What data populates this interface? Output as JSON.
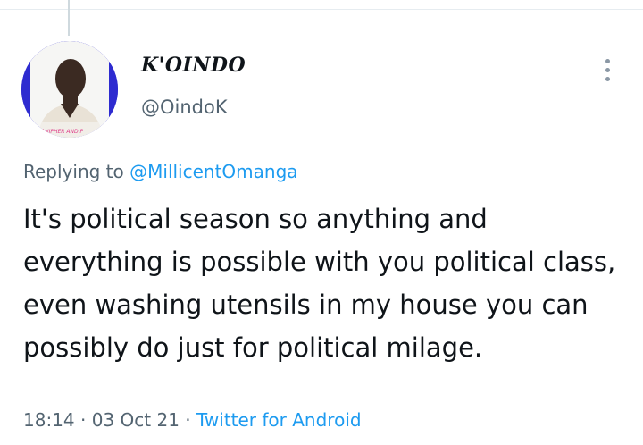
{
  "tweet": {
    "author": {
      "display_name": "K'OINDO",
      "handle": "@OindoK",
      "avatar_caption": "ANIPHER AND P"
    },
    "replying_prefix": "Replying to ",
    "replying_to": "@MillicentOmanga",
    "text": "It's political season so anything and everything is possible with you political class, even washing utensils in my house you can possibly do just for political milage.",
    "time": "18:14",
    "separator": " · ",
    "date": "03 Oct 21",
    "source": "Twitter for Android"
  },
  "icons": {
    "more": "more-vertical-icon"
  },
  "colors": {
    "link": "#1d9bf0",
    "secondary_text": "#536471",
    "primary_text": "#0f1419",
    "avatar_bg": "#2e2bd0"
  }
}
